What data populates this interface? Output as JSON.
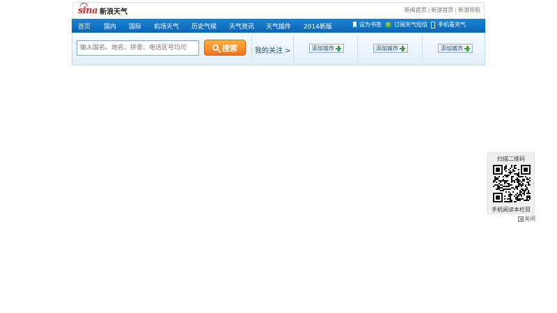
{
  "header": {
    "logo_sina": "sina",
    "logo_weather": "新浪天气",
    "links": [
      "新闻首页",
      "新浪首页",
      "新浪导航"
    ],
    "separator": "|"
  },
  "nav": {
    "items": [
      "首页",
      "国内",
      "国际",
      "机场天气",
      "历史气候",
      "天气资讯",
      "天气插件",
      "2014新版"
    ],
    "right": {
      "bookmark": "设为书签",
      "sms": "订阅天气短信",
      "mobile": "手机看天气"
    }
  },
  "search": {
    "placeholder": "输入国名、地名、拼音、电话区号均可",
    "button_label": "搜索"
  },
  "follow": {
    "label": "我的关注 >",
    "add_city_label": "添加城市"
  },
  "qr": {
    "title": "扫描二维码",
    "caption": "手机阅读本栏目",
    "close_label": "关闭"
  },
  "colors": {
    "nav_bg": "#0a6cbd",
    "search_button": "#f27d20",
    "brand_red": "#d42b2b",
    "plus_green": "#2ea32e"
  }
}
